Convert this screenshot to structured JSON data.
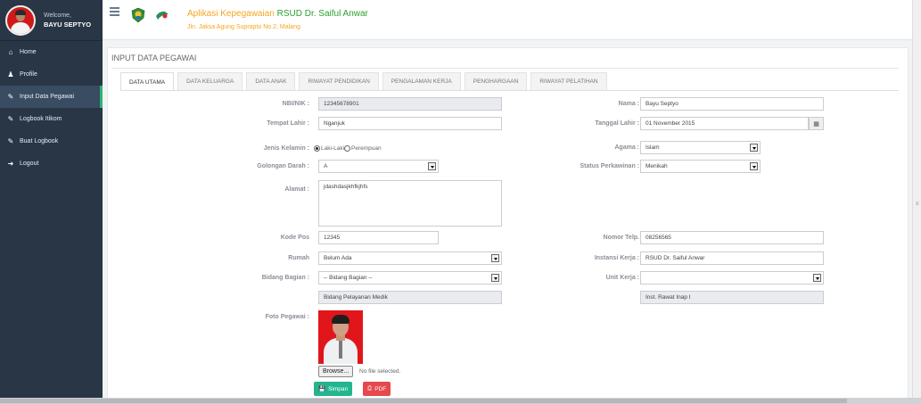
{
  "user": {
    "welcome": "Welcome,",
    "name": "BAYU SEPTYO"
  },
  "sidebar": {
    "items": [
      {
        "label": "Home",
        "icon": "home-icon"
      },
      {
        "label": "Profile",
        "icon": "user-icon"
      },
      {
        "label": "Input Data Pegawai",
        "icon": "edit-icon"
      },
      {
        "label": "Logbook Itikom",
        "icon": "edit-icon"
      },
      {
        "label": "Buat Logbook",
        "icon": "edit-icon"
      },
      {
        "label": "Logout",
        "icon": "sign-out-icon"
      }
    ],
    "active_index": 2,
    "active_accent": "#2bb673"
  },
  "header": {
    "title_prefix": "Aplikasi Kepegawaian",
    "title_hospital": "RSUD Dr. Saiful Anwar",
    "address": "Jln. Jaksa Agung Suprapto No.2, Malang"
  },
  "page": {
    "title": "INPUT DATA PEGAWAI"
  },
  "tabs": [
    {
      "label": "DATA UTAMA",
      "active": true
    },
    {
      "label": "DATA KELUARGA"
    },
    {
      "label": "DATA ANAK"
    },
    {
      "label": "RIWAYAT PENDIDIKAN"
    },
    {
      "label": "PENGALAMAN KERJA"
    },
    {
      "label": "PENGHARGAAN"
    },
    {
      "label": "RIWAYAT PELATIHAN"
    }
  ],
  "form": {
    "nbi": {
      "label": "NBI/NIK :",
      "value": "12345678901"
    },
    "tempat_lahir": {
      "label": "Tempat Lahir :",
      "value": "Nganjuk"
    },
    "jenis_kelamin": {
      "label": "Jenis Kelamin :",
      "opt1": "Laki-Laki",
      "opt2": "Perempuan",
      "selected": "Laki-Laki"
    },
    "golongan_darah": {
      "label": "Golongan Darah :",
      "value": "A"
    },
    "alamat": {
      "label": "Alamat :",
      "value": "jdashdasjkhfkjhfs"
    },
    "kode_pos": {
      "label": "Kode Pos",
      "value": "12345"
    },
    "rumah": {
      "label": "Rumah",
      "value": "Belum Ada"
    },
    "bidang_bagian": {
      "label": "Bidang Bagian :",
      "value": "-- Bidang Bagian --",
      "sub_value": "Bidang Pelayanan Medik"
    },
    "nama": {
      "label": "Nama :",
      "value": "Bayu Septyo"
    },
    "tanggal_lahir": {
      "label": "Tanggal Lahir :",
      "value": "01 November 2015"
    },
    "agama": {
      "label": "Agama :",
      "value": "Islam"
    },
    "status_perkawinan": {
      "label": "Status Perkawinan :",
      "value": "Menikah"
    },
    "nomor_telp": {
      "label": "Nomor Telp.",
      "value": "08256565"
    },
    "instansi_kerja": {
      "label": "Instansi Kerja :",
      "value": "RSUD Dr. Saiful Anwar"
    },
    "unit_kerja": {
      "label": "Unit Kerja :",
      "value": "",
      "sub_value": "Inst. Rawat Inap I"
    },
    "foto": {
      "label": "Foto Pegawai :",
      "browse": "Browse...",
      "no_file": "No file selected."
    }
  },
  "buttons": {
    "save": "Simpan",
    "pdf": "PDF",
    "save_color": "#22b68f",
    "pdf_color": "#e5484d"
  }
}
